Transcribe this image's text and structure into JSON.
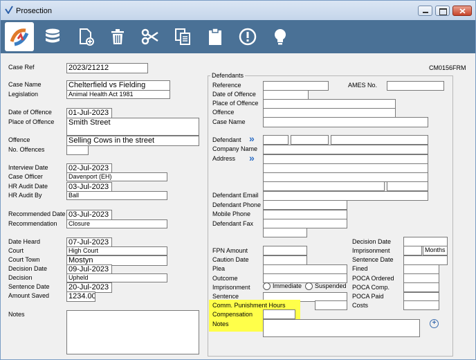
{
  "window": {
    "title": "Prosection"
  },
  "toolbar": {
    "icons": [
      "app-logo-icon",
      "database-icon",
      "new-document-icon",
      "trash-icon",
      "scissors-icon",
      "copy-icon",
      "clipboard-icon",
      "alert-icon",
      "lightbulb-icon"
    ]
  },
  "form_code": "CM0156FRM",
  "left": {
    "case_ref": {
      "label": "Case Ref",
      "value": "2023/21212"
    },
    "case_name": {
      "label": "Case Name",
      "value": "Chelterfield vs Fielding"
    },
    "legislation": {
      "label": "Legislation",
      "value": "Animal Health Act 1981"
    },
    "date_of_offence": {
      "label": "Date of Offence",
      "value": "01-Jul-2023"
    },
    "place_of_offence": {
      "label": "Place of Offence",
      "value": "Smith Street"
    },
    "offence": {
      "label": "Offence",
      "value": "Selling Cows in the street"
    },
    "no_offences": {
      "label": "No. Offences",
      "value": ""
    },
    "interview_date": {
      "label": "Interview Date",
      "value": "02-Jul-2023"
    },
    "case_officer": {
      "label": "Case Officer",
      "value": "Davenport (EH)"
    },
    "hr_audit_date": {
      "label": "HR Audit Date",
      "value": "03-Jul-2023"
    },
    "hr_audit_by": {
      "label": "HR Audit By",
      "value": "Ball"
    },
    "recommended_date": {
      "label": "Recommended Date",
      "value": "03-Jul-2023"
    },
    "recommendation": {
      "label": "Recommendation",
      "value": "Closure"
    },
    "date_heard": {
      "label": "Date Heard",
      "value": "07-Jul-2023"
    },
    "court": {
      "label": "Court",
      "value": "High Court"
    },
    "court_town": {
      "label": "Court Town",
      "value": "Mostyn"
    },
    "decision_date": {
      "label": "Decision Date",
      "value": "09-Jul-2023"
    },
    "decision": {
      "label": "Decision",
      "value": "Upheld"
    },
    "sentence_date": {
      "label": "Sentence Date",
      "value": "20-Jul-2023"
    },
    "amount_saved": {
      "label": "Amount Saved",
      "value": "1234.00"
    },
    "notes": {
      "label": "Notes",
      "value": ""
    }
  },
  "defendants": {
    "group_title": "Defendants",
    "reference": "Reference",
    "ames_no": "AMES No.",
    "date_of_offence": "Date of Offence",
    "place_of_offence": "Place of Offence",
    "offence": "Offence",
    "case_name": "Case Name",
    "defendant": "Defendant",
    "company_name": "Company Name",
    "address": "Address",
    "defendant_email": "Defendant Email",
    "defendant_phone": "Defendant Phone",
    "mobile_phone": "Mobile Phone",
    "defendant_fax": "Defendant Fax",
    "fpn_amount": "FPN Amount",
    "caution_date": "Caution Date",
    "plea": "Plea",
    "outcome": "Outcome",
    "imprisonment": "Imprisonment",
    "immediate": "Immediate",
    "suspended": "Suspended",
    "sentence": "Sentence",
    "comm_punishment_hours": "Comm. Punishment Hours",
    "compensation": "Compensation",
    "notes": "Notes",
    "decision_date": "Decision Date",
    "imprisonment_right": "Imprisonment",
    "months": "Months",
    "sentence_date": "Sentence Date",
    "fined": "Fined",
    "poca_ordered": "POCA Ordered",
    "poca_comp": "POCA Comp.",
    "poca_paid": "POCA Paid",
    "costs": "Costs"
  },
  "colors": {
    "toolbar": "#4a7196",
    "highlight": "#ffff4a",
    "accent": "#2b6cc4"
  }
}
